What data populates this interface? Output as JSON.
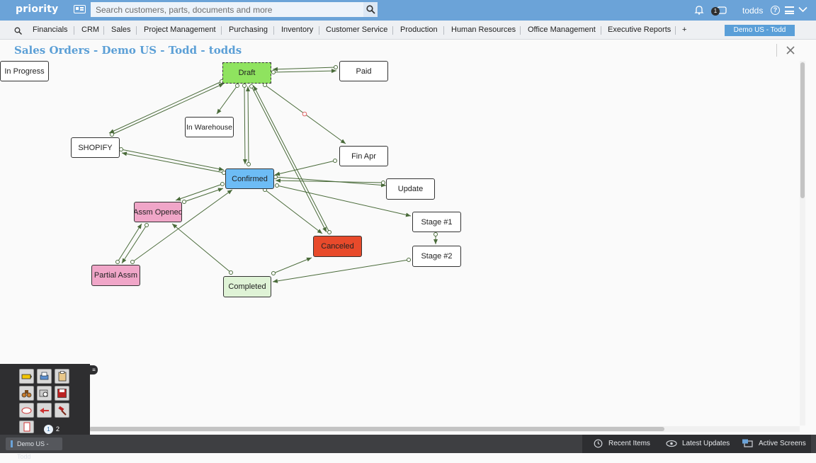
{
  "topbar": {
    "logo": "priority",
    "search_placeholder": "Search customers, parts, documents and more",
    "notification_count": "1",
    "user": "todds",
    "help": "?"
  },
  "menu": {
    "items": [
      "Financials",
      "CRM",
      "Sales",
      "Project Management",
      "Purchasing",
      "Inventory",
      "Customer Service",
      "Production",
      "Human Resources",
      "Office Management",
      "Executive Reports",
      "+"
    ],
    "company": "Demo US - Todd"
  },
  "page": {
    "title": "Sales Orders - Demo US - Todd - todds"
  },
  "diagram": {
    "nodes": {
      "in_progress": "In Progress",
      "draft": "Draft",
      "paid": "Paid",
      "in_warehouse": "In Warehouse",
      "shopify": "SHOPIFY",
      "fin_apr": "Fin Apr",
      "confirmed": "Confirmed",
      "update": "Update",
      "assm_opened": "Assm Opened",
      "stage1": "Stage #1",
      "canceled": "Canceled",
      "stage2": "Stage #2",
      "partial_assm": "Partial Assm",
      "completed": "Completed"
    },
    "colors": {
      "draft": "#8fe35f",
      "confirmed": "#6dbcf5",
      "canceled": "#e84a2b",
      "assm": "#f0a6c8",
      "completed": "#dff3d6",
      "arrow": "#4a6b3a"
    }
  },
  "toolbar": {
    "page": "1",
    "count": "2"
  },
  "statusbar": {
    "open_window": "Demo US - Todd",
    "recent": "Recent Items",
    "updates": "Latest Updates",
    "screens": "Active Screens"
  }
}
